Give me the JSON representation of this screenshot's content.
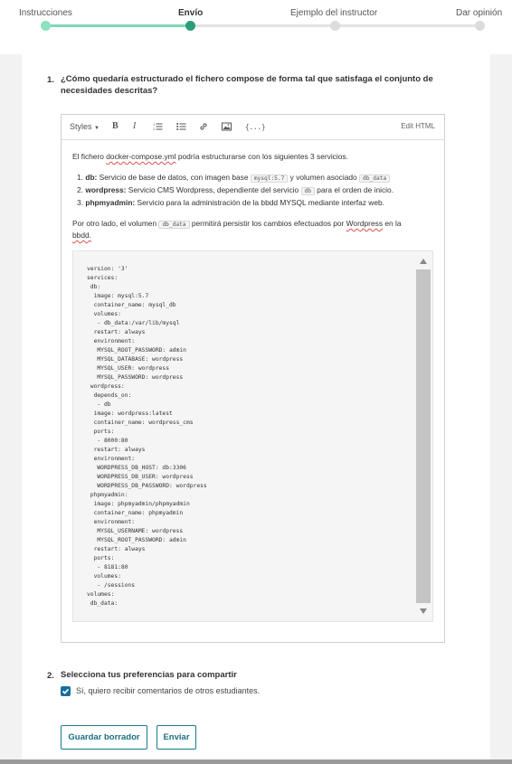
{
  "progress": {
    "steps": [
      {
        "label": "Instrucciones",
        "state": "done"
      },
      {
        "label": "Envío",
        "state": "current"
      },
      {
        "label": "Ejemplo del instructor",
        "state": "todo"
      },
      {
        "label": "Dar opinión",
        "state": "todo"
      }
    ],
    "colors": {
      "done": "#8ee0bf",
      "current": "#2a9d7a",
      "todo": "#dcdcdc"
    }
  },
  "question1": {
    "number": "1.",
    "text_line1": "¿Cómo quedaría estructurado el fichero compose de forma tal que satisfaga el conjunto de",
    "text_line2": "necesidades descritas?"
  },
  "editor": {
    "toolbar": {
      "styles": "Styles",
      "bold": "B",
      "italic": "I",
      "edit_html": "Edit HTML"
    },
    "intro": {
      "pre": "El fichero ",
      "filename": "docker-compose.yml",
      "post": "  podría estructurarse con los siguientes 3 servicios."
    },
    "services": [
      {
        "num": "1.",
        "name": "db:",
        "pre": " Servicio de base de datos, con imagen base ",
        "chip1": "mysql:5.7",
        "mid": " y volumen asociado ",
        "chip2": "db_data"
      },
      {
        "num": "2.",
        "name": "wordpress:",
        "pre": " Servicio CMS Wordpress, dependiente del servicio ",
        "chip1": "db",
        "mid": " para el orden de inicio."
      },
      {
        "num": "3.",
        "name": "phpmyadmin:",
        "pre": " Servicio para la administración de la bbdd MYSQL mediante interfaz web."
      }
    ],
    "volume_note": {
      "pre": "Por otro lado, el volumen ",
      "chip": "db_data",
      "mid": " permitirá persistir los cambios efectuados por ",
      "wp": "Wordpress",
      "post": " en la",
      "line2": "bbdd."
    },
    "code": "version: '3'\nservices:\n db:\n  image: mysql:5.7\n  container_name: mysql_db\n  volumes:\n   - db_data:/var/lib/mysql\n  restart: always\n  environment:\n   MYSQL_ROOT_PASSWORD: admin\n   MYSQL_DATABASE: wordpress\n   MYSQL_USER: wordpress\n   MYSQL_PASSWORD: wordpress\n wordpress:\n  depends_on:\n   - db\n  image: wordpress:latest\n  container_name: wordpress_cms\n  ports:\n   - 8000:80\n  restart: always\n  environment:\n   WORDPRESS_DB_HOST: db:3306\n   WORDPRESS_DB_USER: wordpress\n   WORDPRESS_DB_PASSWORD: wordpress\n phpmyadmin:\n  image: phpmyadmin/phpmyadmin\n  container_name: phpmyadmin\n  environment:\n   MYSQL_USERNAME: wordpress\n   MYSQL_ROOT_PASSWORD: admin\n  restart: always\n  ports:\n   - 8181:80\n  volumes:\n   - /sessions\nvolumes:\n db_data:"
  },
  "question2": {
    "number": "2.",
    "text": "Selecciona tus preferencias para compartir",
    "checkbox_label": "Sí, quiero recibir comentarios de otros estudiantes.",
    "checked": true
  },
  "buttons": {
    "save_draft": "Guardar borrador",
    "submit": "Enviar"
  }
}
